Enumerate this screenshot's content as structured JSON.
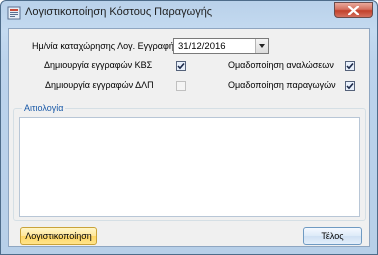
{
  "window": {
    "title": "Λογιστικοποίηση Κόστους Παραγωγής"
  },
  "form": {
    "date_label": "Ημ/νία καταχώρησης Λογ. Εγγραφής",
    "date_value": "31/12/2016",
    "options": {
      "create_kbs_label": "Δημιουργία εγγραφών ΚΒΣ",
      "create_kbs_checked": true,
      "create_dlp_label": "Δημιουργία εγγραφών ΔΛΠ",
      "create_dlp_checked": false,
      "group_consumption_label": "Ομαδοποίηση αναλώσεων",
      "group_consumption_checked": true,
      "group_production_label": "Ομαδοποίηση παραγωγών",
      "group_production_checked": true
    },
    "justification": {
      "label": "Αιτιολογία",
      "value": ""
    }
  },
  "buttons": {
    "post_label": "Λογιστικοποίηση",
    "end_label": "Τέλος"
  },
  "icons": {
    "app": "ledger-app-icon",
    "close": "close-icon",
    "dropdown": "chevron-down-icon",
    "check": "check-icon"
  },
  "colors": {
    "title_bar": "#bcd3ec",
    "group_label": "#1a5aa8",
    "close_button": "#c2402a",
    "post_button": "#ffd765"
  }
}
